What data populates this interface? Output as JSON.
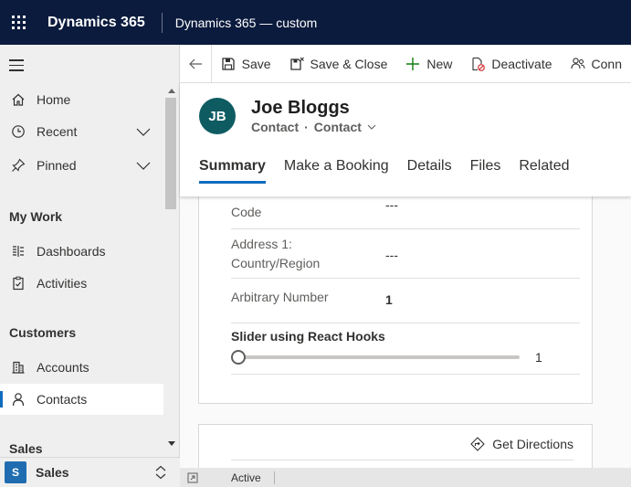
{
  "topbar": {
    "app_name": "Dynamics 365",
    "app_subtitle": "Dynamics 365 — custom"
  },
  "sidebar": {
    "items": [
      {
        "label": "Home",
        "icon": "home-icon"
      },
      {
        "label": "Recent",
        "icon": "clock-icon"
      },
      {
        "label": "Pinned",
        "icon": "pin-icon"
      }
    ],
    "groups": [
      {
        "title": "My Work",
        "items": [
          {
            "label": "Dashboards",
            "icon": "dashboard-icon"
          },
          {
            "label": "Activities",
            "icon": "clipboard-icon"
          }
        ]
      },
      {
        "title": "Customers",
        "items": [
          {
            "label": "Accounts",
            "icon": "building-icon"
          },
          {
            "label": "Contacts",
            "icon": "person-icon",
            "active": true
          }
        ]
      },
      {
        "title": "Sales",
        "items": []
      }
    ],
    "area": {
      "badge": "S",
      "label": "Sales"
    }
  },
  "commands": [
    {
      "label": "Save",
      "icon": "save-icon"
    },
    {
      "label": "Save & Close",
      "icon": "save-close-icon"
    },
    {
      "label": "New",
      "icon": "plus-icon"
    },
    {
      "label": "Deactivate",
      "icon": "deactivate-icon"
    },
    {
      "label": "Conn",
      "icon": "connect-icon"
    }
  ],
  "record": {
    "initials": "JB",
    "name": "Joe Bloggs",
    "entity": "Contact",
    "form": "Contact",
    "separator": "·",
    "tabs": [
      "Summary",
      "Make a Booking",
      "Details",
      "Files",
      "Related"
    ],
    "active_tab": "Summary"
  },
  "fields": [
    {
      "label": "Code",
      "value": "---"
    },
    {
      "label": "Address 1:",
      "label2": "Country/Region",
      "value": "---"
    },
    {
      "label": "Arbitrary Number",
      "value": "1"
    }
  ],
  "slider": {
    "title": "Slider using React Hooks",
    "value": "1",
    "level": 0
  },
  "directions": {
    "label": "Get Directions"
  },
  "status": {
    "text": "Active"
  },
  "colors": {
    "topbar": "#0b1b3d",
    "accent": "#0f6cbd",
    "avatar": "#0e5c62",
    "new_icon": "#107c10",
    "deactivate_icon": "#d13438"
  }
}
